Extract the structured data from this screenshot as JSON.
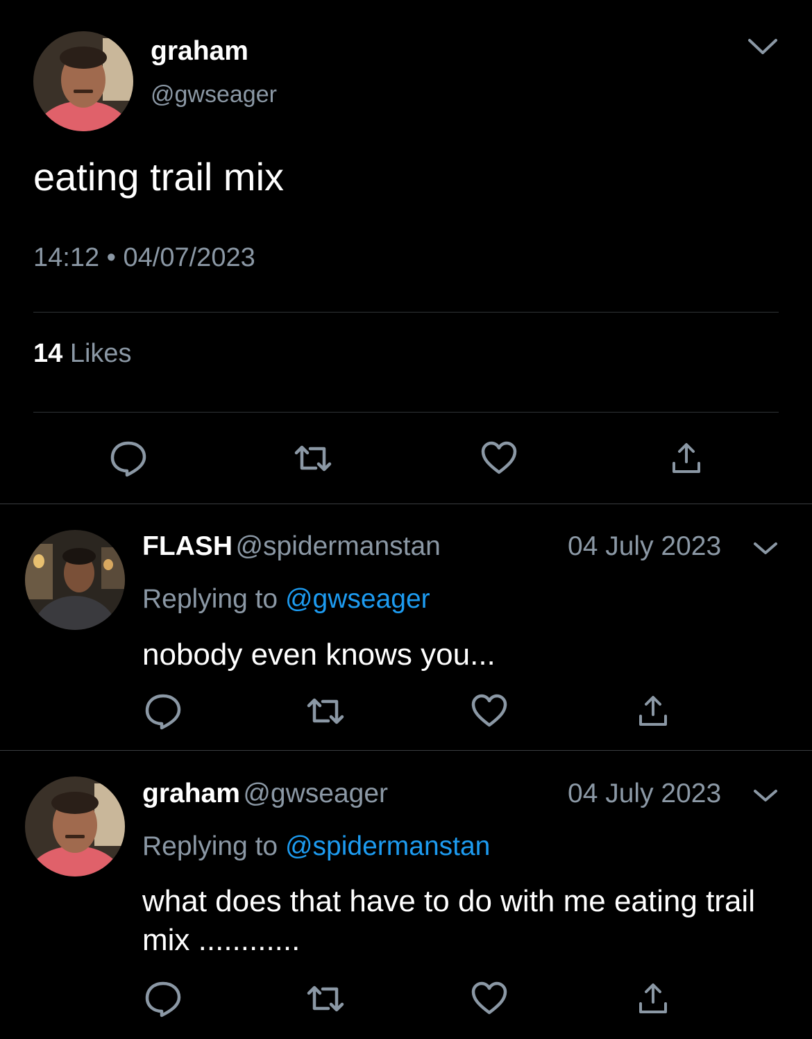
{
  "main_tweet": {
    "author_name": "graham",
    "author_handle": "@gwseager",
    "text": "eating trail mix",
    "time": "14:12",
    "date": "04/07/2023",
    "separator": "•",
    "likes_count": "14",
    "likes_label": "Likes"
  },
  "replies": [
    {
      "author_name": "FLASH",
      "author_handle": "@spidermanstan",
      "date": "04 July 2023",
      "replying_prefix": "Replying to",
      "replying_to": "@gwseager",
      "text": "nobody even knows you..."
    },
    {
      "author_name": "graham",
      "author_handle": "@gwseager",
      "date": "04 July 2023",
      "replying_prefix": "Replying to",
      "replying_to": "@spidermanstan",
      "text": "what does that have to do with me eating trail mix ............"
    }
  ],
  "icons": [
    "chevron-down-icon",
    "reply-icon",
    "retweet-icon",
    "like-icon",
    "share-icon"
  ],
  "colors": {
    "background": "#000000",
    "secondary_text": "#8b98a5",
    "link": "#1d9bf0",
    "divider": "#2f3336",
    "icon": "#8b98a5"
  }
}
